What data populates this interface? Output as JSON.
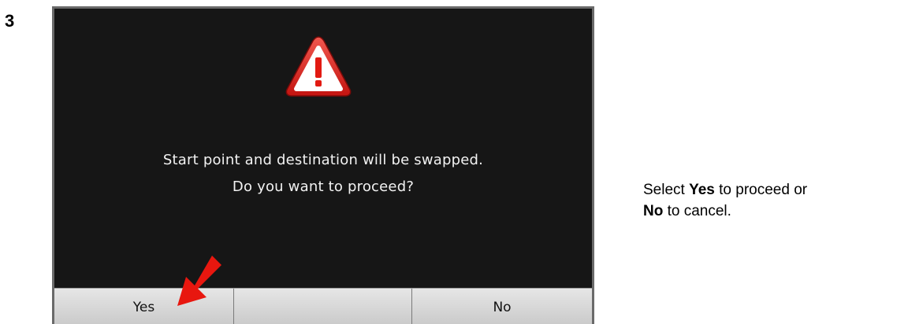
{
  "step": {
    "number": "3"
  },
  "dialog": {
    "icon": "warning-triangle-icon",
    "message_line1": "Start point and destination will be swapped.",
    "message_line2": "Do you want to proceed?"
  },
  "softkeys": {
    "yes_label": "Yes",
    "middle_label": "",
    "no_label": "No"
  },
  "instruction": {
    "t1": "Select ",
    "yes": "Yes",
    "t2": " to proceed or ",
    "no": "No",
    "t3": " to cancel."
  },
  "colors": {
    "screen_bg": "#161616",
    "accent_red": "#e8170f",
    "softkey_bg": "#d6d6d6"
  },
  "annotation": {
    "icon": "red-pointer-arrow-icon"
  }
}
